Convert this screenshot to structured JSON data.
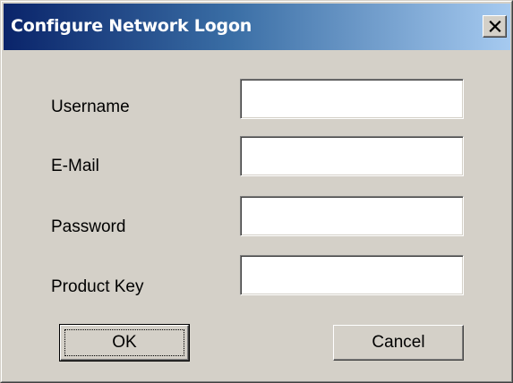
{
  "window": {
    "title": "Configure Network Logon"
  },
  "icons": {
    "close": "close-icon"
  },
  "form": {
    "fields": [
      {
        "label": "Username",
        "value": "",
        "placeholder": ""
      },
      {
        "label": "E-Mail",
        "value": "",
        "placeholder": ""
      },
      {
        "label": "Password",
        "value": "",
        "placeholder": ""
      },
      {
        "label": "Product Key",
        "value": "",
        "placeholder": ""
      }
    ]
  },
  "buttons": {
    "ok_label": "OK",
    "cancel_label": "Cancel"
  },
  "colors": {
    "titlebar_start": "#0a246a",
    "titlebar_end": "#a6caf0",
    "dialog_face": "#d4d0c8"
  }
}
